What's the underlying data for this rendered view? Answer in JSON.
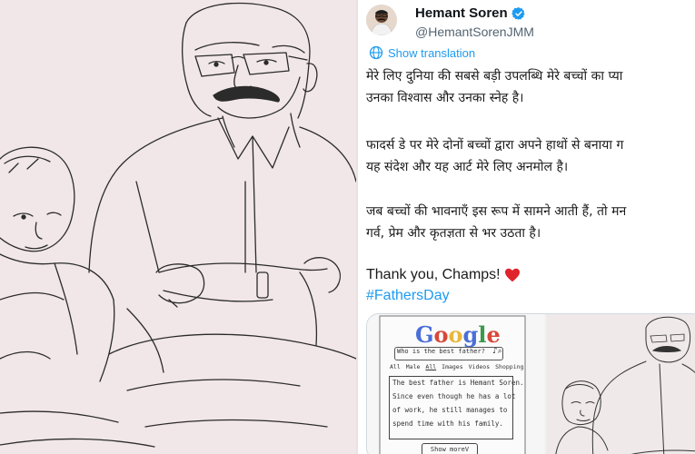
{
  "tweet": {
    "display_name": "Hemant Soren",
    "handle": "@HemantSorenJMM",
    "verified": true,
    "show_translation": "Show translation",
    "paragraphs": [
      [
        "मेरे लिए दुनिया की सबसे बड़ी उपलब्धि मेरे बच्चों का प्या",
        "उनका विश्वास और उनका स्नेह है।"
      ],
      [
        "फादर्स डे पर मेरे दोनों बच्चों द्वारा अपने हाथों से बनाया ग",
        "यह संदेश और यह आर्ट मेरे लिए अनमोल है।"
      ],
      [
        "जब बच्चों की भावनाएँ इस रूप में सामने आती हैं, तो मन",
        "गर्व, प्रेम और कृतज्ञता से भर उठता है।"
      ]
    ],
    "thanks": "Thank you, Champs!",
    "heart_icon": "red-heart-icon",
    "hashtag": "#FathersDay",
    "colors": {
      "link": "#1d9bf0",
      "verified": "#1d9bf0",
      "heart": "#e0242b"
    }
  },
  "media": {
    "drawing": {
      "logo": [
        "G",
        "o",
        "o",
        "g",
        "l",
        "e"
      ],
      "logo_colors": [
        "#4a6fd8",
        "#d9473a",
        "#e8b83a",
        "#4a6fd8",
        "#3a9a4a",
        "#d9473a"
      ],
      "search_query": "Who is the best father?",
      "tabs": [
        "All",
        "Male",
        "All",
        "Images",
        "Videos",
        "Shopping"
      ],
      "result_lines": [
        "The best father is Hemant Soren.",
        "Since even though he has a lot",
        "of work, he still manages to",
        "spend time with his family."
      ],
      "show_more": "Show moreV"
    }
  }
}
